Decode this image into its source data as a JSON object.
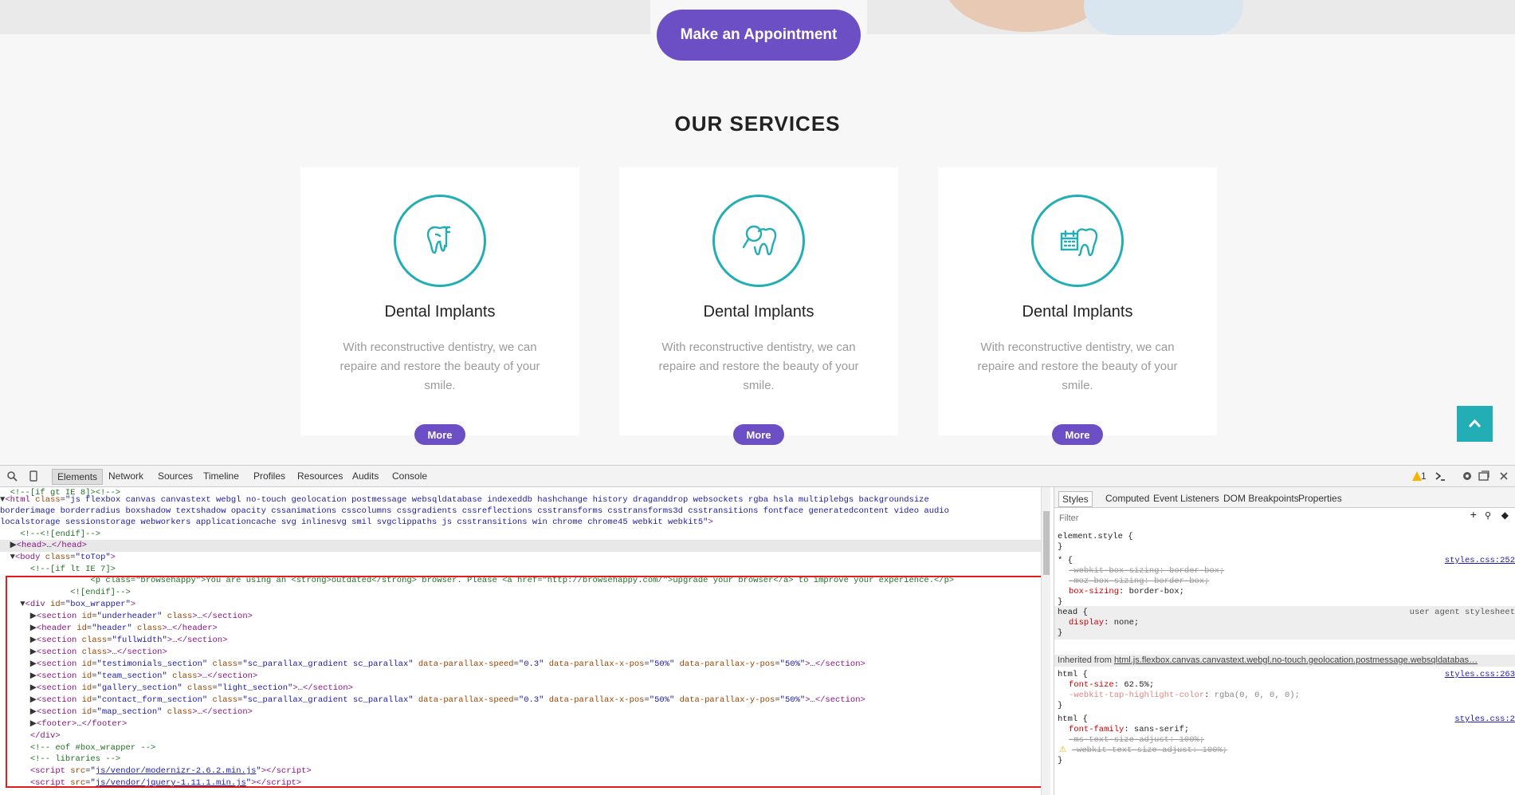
{
  "site": {
    "appointment_label": "Make an Appointment",
    "services_heading": "OUR SERVICES",
    "services": [
      {
        "title": "Dental Implants",
        "description": "With reconstructive dentistry, we can repaire and restore the beauty of your smile.",
        "more_label": "More",
        "icon": "tooth-tool-icon"
      },
      {
        "title": "Dental Implants",
        "description": "With reconstructive dentistry, we can repaire and restore the beauty of your smile.",
        "more_label": "More",
        "icon": "tooth-magnifier-icon"
      },
      {
        "title": "Dental Implants",
        "description": "With reconstructive dentistry, we can repaire and restore the beauty of your smile.",
        "more_label": "More",
        "icon": "tooth-calendar-icon"
      }
    ],
    "accent": "#6c4fc4",
    "teal": "#22aeb4"
  },
  "devtools": {
    "tabs": [
      "Elements",
      "Network",
      "Sources",
      "Timeline",
      "Profiles",
      "Resources",
      "Audits",
      "Console"
    ],
    "warning_count": "1",
    "side_tabs": [
      "Styles",
      "Computed",
      "Event Listeners",
      "DOM Breakpoints",
      "Properties"
    ],
    "filter_placeholder": "Filter",
    "styles": {
      "element_style": "element.style {",
      "src1": "styles.css:252",
      "src2": "styles.css:263",
      "src3": "styles.css:2",
      "ua": "user agent stylesheet",
      "inherited_prefix": "Inherited from",
      "inherited_from": "html.js.flexbox.canvas.canvastext.webgl.no-touch.geolocation.postmessage.websqldatabas…"
    }
  }
}
